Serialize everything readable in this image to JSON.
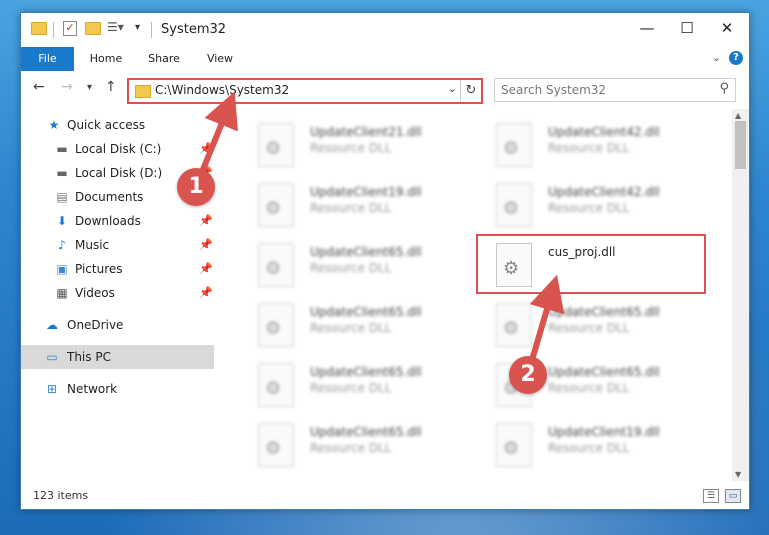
{
  "window": {
    "title": "System32",
    "controls": {
      "minimize": "—",
      "maximize": "☐",
      "close": "✕"
    }
  },
  "ribbon": {
    "tabs": [
      "File",
      "Home",
      "Share",
      "View"
    ],
    "help": "?"
  },
  "nav": {
    "address": "C:\\Windows\\System32",
    "search_placeholder": "Search System32"
  },
  "sidebar": {
    "items": [
      {
        "label": "Quick access",
        "icon": "star-icon",
        "pinned": false
      },
      {
        "label": "Local Disk (C:)",
        "icon": "drive-icon",
        "pinned": true
      },
      {
        "label": "Local Disk (D:)",
        "icon": "drive-icon",
        "pinned": true
      },
      {
        "label": "Documents",
        "icon": "documents-icon",
        "pinned": true
      },
      {
        "label": "Downloads",
        "icon": "download-icon",
        "pinned": true
      },
      {
        "label": "Music",
        "icon": "music-icon",
        "pinned": true
      },
      {
        "label": "Pictures",
        "icon": "pictures-icon",
        "pinned": true
      },
      {
        "label": "Videos",
        "icon": "videos-icon",
        "pinned": true
      },
      {
        "label": "OneDrive",
        "icon": "cloud-icon",
        "pinned": false
      },
      {
        "label": "This PC",
        "icon": "computer-icon",
        "pinned": false,
        "selected": true
      },
      {
        "label": "Network",
        "icon": "network-icon",
        "pinned": false
      }
    ]
  },
  "files": {
    "left": [
      {
        "name": "UpdateClient21.dll",
        "type": "Resource DLL"
      },
      {
        "name": "UpdateClient19.dll",
        "type": "Resource DLL"
      },
      {
        "name": "UpdateClient65.dll",
        "type": "Resource DLL"
      },
      {
        "name": "UpdateClient65.dll",
        "type": "Resource DLL"
      },
      {
        "name": "UpdateClient65.dll",
        "type": "Resource DLL"
      },
      {
        "name": "UpdateClient65.dll",
        "type": "Resource DLL"
      }
    ],
    "right": [
      {
        "name": "UpdateClient42.dll",
        "type": "Resource DLL"
      },
      {
        "name": "UpdateClient42.dll",
        "type": "Resource DLL"
      },
      {
        "name": "cus_proj.dll",
        "type": "",
        "highlighted": true
      },
      {
        "name": "UpdateClient65.dll",
        "type": "Resource DLL"
      },
      {
        "name": "UpdateClient65.dll",
        "type": "Resource DLL"
      },
      {
        "name": "UpdateClient19.dll",
        "type": "Resource DLL"
      }
    ]
  },
  "status": {
    "items_count": "123 items"
  },
  "annotations": {
    "step1": "1",
    "step2": "2",
    "color": "#d9534f"
  }
}
